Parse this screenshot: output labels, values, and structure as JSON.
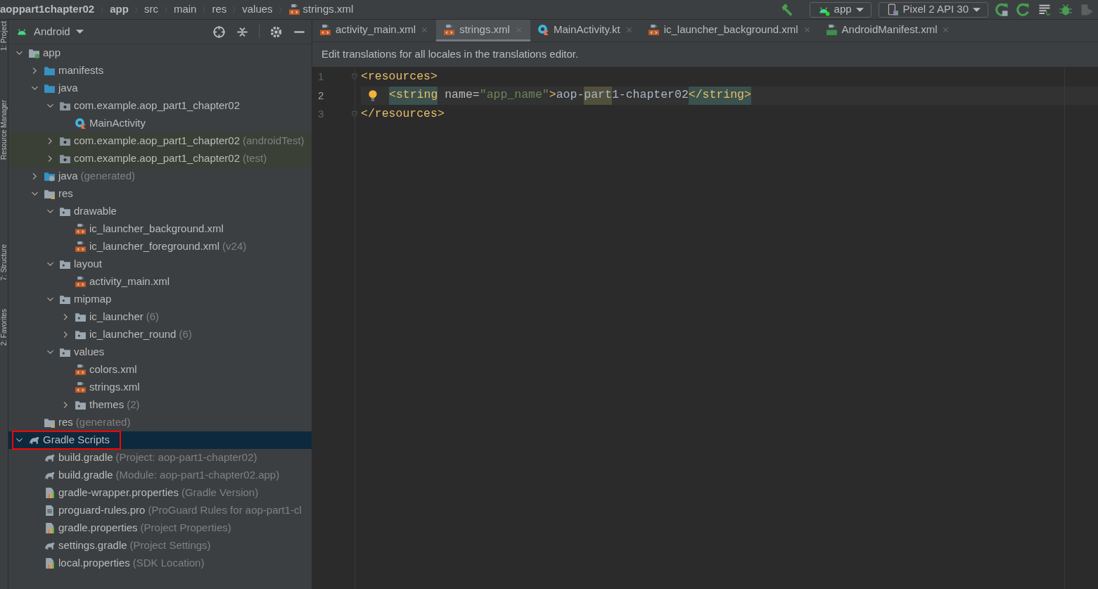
{
  "breadcrumb": [
    {
      "label": "aoppart1chapter02",
      "bold": true,
      "kind": "module"
    },
    {
      "label": "app",
      "bold": true,
      "kind": "module"
    },
    {
      "label": "src",
      "bold": false,
      "kind": "directory"
    },
    {
      "label": "main",
      "bold": false,
      "kind": "directory"
    },
    {
      "label": "res",
      "bold": false,
      "kind": "directory"
    },
    {
      "label": "values",
      "bold": false,
      "kind": "directory"
    },
    {
      "label": "strings.xml",
      "bold": false,
      "kind": "xml"
    }
  ],
  "toolbar": {
    "config": "app",
    "device": "Pixel 2 API 30"
  },
  "side_strip": [
    "1: Project",
    "Resource Manager",
    "7: Structure",
    "2: Favorites"
  ],
  "project_panel": {
    "view": "Android",
    "tree": [
      {
        "label": "app",
        "kind": "module",
        "expanded": true,
        "children": [
          {
            "label": "manifests",
            "kind": "source-folder",
            "expanded": false
          },
          {
            "label": "java",
            "kind": "source-folder",
            "expanded": true,
            "children": [
              {
                "label": "com.example.aop_part1_chapter02",
                "kind": "package",
                "expanded": true,
                "children": [
                  {
                    "label": "MainActivity",
                    "kind": "kotlin-class"
                  }
                ]
              },
              {
                "label": "com.example.aop_part1_chapter02",
                "suffix": "(androidTest)",
                "kind": "package",
                "expanded": false,
                "test": true
              },
              {
                "label": "com.example.aop_part1_chapter02",
                "suffix": "(test)",
                "kind": "package",
                "expanded": false,
                "test": true
              }
            ]
          },
          {
            "label": "java",
            "suffix": "(generated)",
            "kind": "generated-folder",
            "expanded": false
          },
          {
            "label": "res",
            "kind": "res-folder",
            "expanded": true,
            "children": [
              {
                "label": "drawable",
                "kind": "folder",
                "expanded": true,
                "children": [
                  {
                    "label": "ic_launcher_background.xml",
                    "kind": "xml"
                  },
                  {
                    "label": "ic_launcher_foreground.xml",
                    "suffix": "(v24)",
                    "kind": "xml"
                  }
                ]
              },
              {
                "label": "layout",
                "kind": "folder",
                "expanded": true,
                "children": [
                  {
                    "label": "activity_main.xml",
                    "kind": "xml"
                  }
                ]
              },
              {
                "label": "mipmap",
                "kind": "folder",
                "expanded": true,
                "children": [
                  {
                    "label": "ic_launcher",
                    "suffix": "(6)",
                    "kind": "folder",
                    "expanded": false
                  },
                  {
                    "label": "ic_launcher_round",
                    "suffix": "(6)",
                    "kind": "folder",
                    "expanded": false
                  }
                ]
              },
              {
                "label": "values",
                "kind": "folder",
                "expanded": true,
                "children": [
                  {
                    "label": "colors.xml",
                    "kind": "xml"
                  },
                  {
                    "label": "strings.xml",
                    "kind": "xml"
                  },
                  {
                    "label": "themes",
                    "suffix": "(2)",
                    "kind": "folder",
                    "expanded": false
                  }
                ]
              }
            ]
          },
          {
            "label": "res",
            "suffix": "(generated)",
            "kind": "res-folder"
          }
        ]
      },
      {
        "label": "Gradle Scripts",
        "kind": "gradle",
        "expanded": true,
        "selected": true,
        "annotated": true,
        "children": [
          {
            "label": "build.gradle",
            "suffix": "(Project: aop-part1-chapter02)",
            "kind": "gradle"
          },
          {
            "label": "build.gradle",
            "suffix": "(Module: aop-part1-chapter02.app)",
            "kind": "gradle"
          },
          {
            "label": "gradle-wrapper.properties",
            "suffix": "(Gradle Version)",
            "kind": "properties"
          },
          {
            "label": "proguard-rules.pro",
            "suffix": "(ProGuard Rules for aop-part1-cl",
            "kind": "text-file"
          },
          {
            "label": "gradle.properties",
            "suffix": "(Project Properties)",
            "kind": "properties"
          },
          {
            "label": "settings.gradle",
            "suffix": "(Project Settings)",
            "kind": "gradle"
          },
          {
            "label": "local.properties",
            "suffix": "(SDK Location)",
            "kind": "properties"
          }
        ]
      }
    ]
  },
  "tabs": [
    {
      "label": "activity_main.xml",
      "kind": "xml",
      "selected": false
    },
    {
      "label": "strings.xml",
      "kind": "xml",
      "selected": true
    },
    {
      "label": "MainActivity.kt",
      "kind": "kotlin-class",
      "selected": false
    },
    {
      "label": "ic_launcher_background.xml",
      "kind": "xml",
      "selected": false
    },
    {
      "label": "AndroidManifest.xml",
      "kind": "manifest",
      "selected": false
    }
  ],
  "banner": "Edit translations for all locales in the translations editor.",
  "code": [
    {
      "number": "1",
      "current": false,
      "fold": true,
      "bulb": false,
      "tokens": [
        {
          "text": "<resources>",
          "kind": "tag",
          "match": false
        }
      ]
    },
    {
      "number": "2",
      "current": true,
      "fold": false,
      "bulb": true,
      "tokens": [
        {
          "text": "<string",
          "kind": "tag",
          "match": true
        },
        {
          "text": " name=",
          "kind": "attr",
          "match": false
        },
        {
          "text": "\"app_name\"",
          "kind": "value",
          "match": false
        },
        {
          "text": ">",
          "kind": "tag",
          "match": false
        },
        {
          "text": "aop-",
          "kind": "text",
          "match": false
        },
        {
          "text": "part",
          "kind": "text",
          "match": true
        },
        {
          "text": "1-chapter02",
          "kind": "text",
          "match": false
        },
        {
          "text": "</string>",
          "kind": "tag",
          "match": true
        }
      ]
    },
    {
      "number": "3",
      "current": false,
      "fold": true,
      "bulb": false,
      "tokens": [
        {
          "text": "</resources>",
          "kind": "tag",
          "match": false
        }
      ]
    }
  ]
}
